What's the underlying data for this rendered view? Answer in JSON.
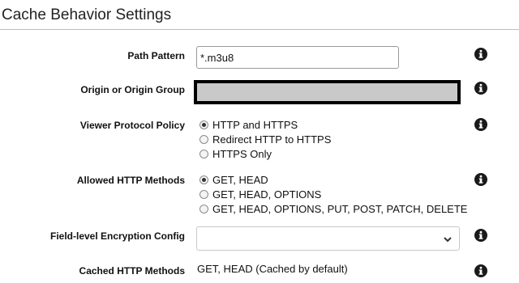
{
  "section": {
    "title": "Cache Behavior Settings"
  },
  "path_pattern": {
    "label": "Path Pattern",
    "value": "*.m3u8"
  },
  "origin": {
    "label": "Origin or Origin Group"
  },
  "viewer_protocol": {
    "label": "Viewer Protocol Policy",
    "options": [
      "HTTP and HTTPS",
      "Redirect HTTP to HTTPS",
      "HTTPS Only"
    ],
    "selected_index": 0
  },
  "allowed_methods": {
    "label": "Allowed HTTP Methods",
    "options": [
      "GET, HEAD",
      "GET, HEAD, OPTIONS",
      "GET, HEAD, OPTIONS, PUT, POST, PATCH, DELETE"
    ],
    "selected_index": 0
  },
  "field_encryption": {
    "label": "Field-level Encryption Config",
    "value": ""
  },
  "cached_methods": {
    "label": "Cached HTTP Methods",
    "value": "GET, HEAD (Cached by default)"
  },
  "icons": {
    "info": "info-circle-icon",
    "dropdown": "chevron-down-icon"
  }
}
